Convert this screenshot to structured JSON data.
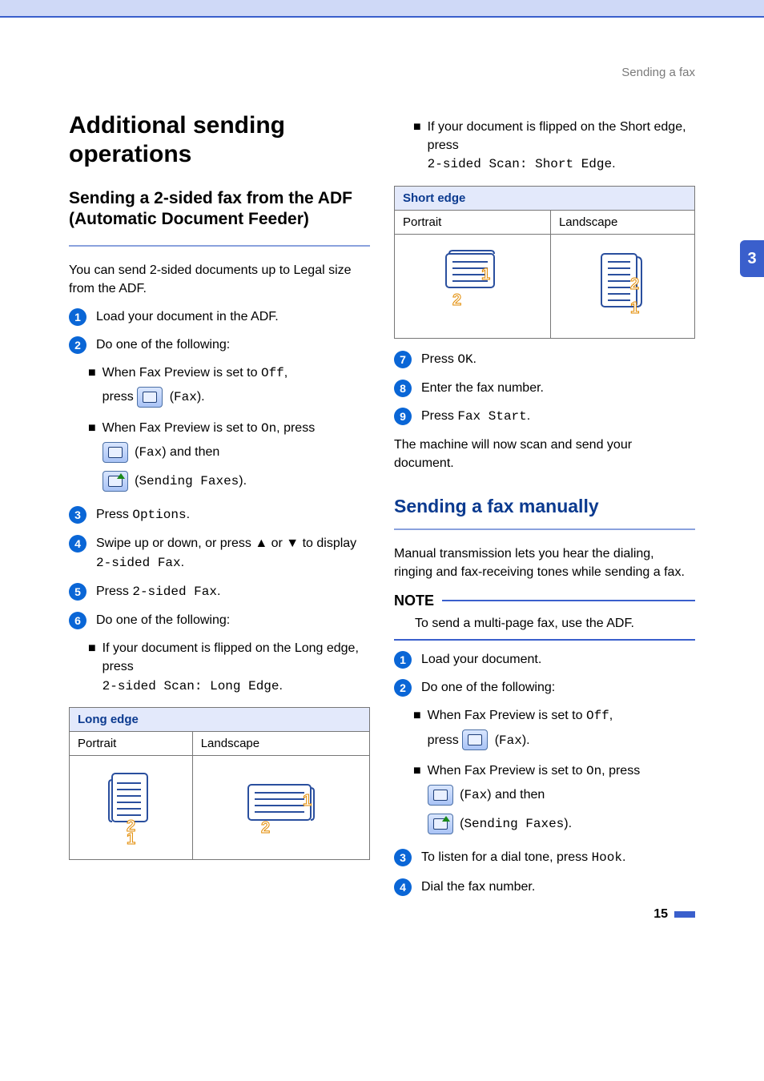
{
  "runhead": "Sending a fax",
  "chapter_tab": "3",
  "page_number": "15",
  "h1": "Additional sending operations",
  "sec1": {
    "title": "Sending a 2-sided fax from the ADF (Automatic Document Feeder)",
    "intro": "You can send 2-sided documents up to Legal size from the ADF.",
    "step1": "Load your document in the ADF.",
    "step2": "Do one of the following:",
    "s2a_pre": "When Fax Preview is set to ",
    "s2a_off": "Off",
    "s2a_post": ",",
    "s2a_line2_pre": "press ",
    "s2a_fax": "Fax",
    "s2b_pre": "When Fax Preview is set to ",
    "s2b_on": "On",
    "s2b_post": ", press",
    "s2b_fax": "Fax",
    "s2b_and": " and then",
    "s2b_send": "Sending Faxes",
    "step3_pre": "Press ",
    "step3_mono": "Options",
    "step4_a": "Swipe up or down, or press ",
    "step4_up": "▲",
    "step4_mid": " or ",
    "step4_down": "▼",
    "step4_b": " to display ",
    "step4_mono": "2-sided Fax",
    "step5_pre": "Press ",
    "step5_mono": "2-sided Fax",
    "step6": "Do one of the following:",
    "s6a_a": "If your document is flipped on the Long edge, press",
    "s6a_mono": "2-sided Scan: Long Edge",
    "s6b_a": "If your document is flipped on the Short edge, press",
    "s6b_mono": "2-sided Scan: Short Edge",
    "long_table": {
      "caption": "Long edge",
      "col1": "Portrait",
      "col2": "Landscape"
    },
    "short_table": {
      "caption": "Short edge",
      "col1": "Portrait",
      "col2": "Landscape"
    },
    "step7_pre": "Press ",
    "step7_mono": "OK",
    "step8": "Enter the fax number.",
    "step9_pre": "Press ",
    "step9_mono": "Fax Start",
    "outro": "The machine will now scan and send your document."
  },
  "sec2": {
    "title": "Sending a fax manually",
    "intro": "Manual transmission lets you hear the dialing, ringing and fax-receiving tones while sending a fax.",
    "note_label": "NOTE",
    "note_body": "To send a multi-page fax, use the ADF.",
    "step1": "Load your document.",
    "step2": "Do one of the following:",
    "s2a_pre": "When Fax Preview is set to ",
    "s2a_off": "Off",
    "s2a_post": ",",
    "s2a_line2_pre": "press ",
    "s2a_fax": "Fax",
    "s2b_pre": "When Fax Preview is set to ",
    "s2b_on": "On",
    "s2b_post": ", press",
    "s2b_fax": "Fax",
    "s2b_and": " and then",
    "s2b_send": "Sending Faxes",
    "step3_pre": "To listen for a dial tone, press ",
    "step3_mono": "Hook",
    "step4": "Dial the fax number."
  }
}
